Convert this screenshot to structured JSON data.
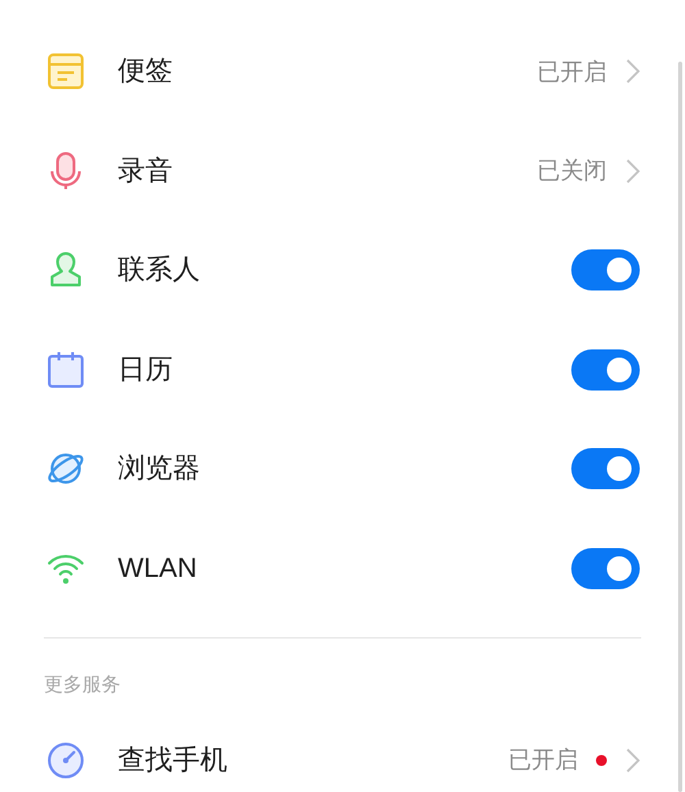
{
  "sections": [
    {
      "items": [
        {
          "kind": "link",
          "label": "便签",
          "value": "已开启",
          "dot": false
        },
        {
          "kind": "link",
          "label": "录音",
          "value": "已关闭",
          "dot": false
        },
        {
          "kind": "toggle",
          "label": "联系人",
          "on": true
        },
        {
          "kind": "toggle",
          "label": "日历",
          "on": true
        },
        {
          "kind": "toggle",
          "label": "浏览器",
          "on": true
        },
        {
          "kind": "toggle",
          "label": "WLAN",
          "on": true
        }
      ]
    },
    {
      "header": "更多服务",
      "items": [
        {
          "kind": "link",
          "label": "查找手机",
          "value": "已开启",
          "dot": true
        }
      ]
    }
  ]
}
